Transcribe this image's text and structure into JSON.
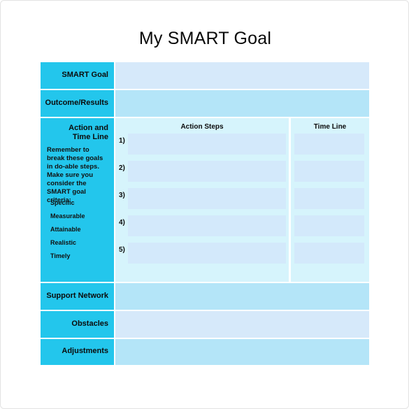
{
  "document": {
    "title": "My SMART Goal"
  },
  "colors": {
    "label_cyan": "#23c6ec",
    "content_light_blue": "#d6e9fa",
    "content_cyan_blue": "#b4e5f8",
    "action_panel": "#d6f4fc",
    "input_box": "#d3e9fb",
    "page_border": "#e3e3e3",
    "text": "#0b0b0b"
  },
  "table": {
    "rows": [
      {
        "id": "smart-goal",
        "label": "SMART Goal",
        "value": "",
        "placeholder": ""
      },
      {
        "id": "outcome-results",
        "label": "Outcome/Results",
        "value": "",
        "placeholder": ""
      },
      {
        "id": "support-network",
        "label": "Support Network",
        "value": "",
        "placeholder": ""
      },
      {
        "id": "obstacles",
        "label": "Obstacles",
        "value": "",
        "placeholder": ""
      },
      {
        "id": "adjustments",
        "label": "Adjustments",
        "value": "",
        "placeholder": ""
      }
    ],
    "action_section": {
      "heading_line1": "Action and",
      "heading_line2": "Time Line",
      "instructions": "Remember to break these goals in do-able steps.  Make sure you consider the SMART goal criteria:",
      "criteria": [
        "Specific",
        "Measurable",
        "Attainable",
        "Realistic",
        "Timely"
      ],
      "columns": {
        "action_steps_header": "Action Steps",
        "time_line_header": "Time Line"
      },
      "steps": [
        {
          "number": "1)",
          "action": "",
          "time": ""
        },
        {
          "number": "2)",
          "action": "",
          "time": ""
        },
        {
          "number": "3)",
          "action": "",
          "time": ""
        },
        {
          "number": "4)",
          "action": "",
          "time": ""
        },
        {
          "number": "5)",
          "action": "",
          "time": ""
        }
      ]
    }
  }
}
